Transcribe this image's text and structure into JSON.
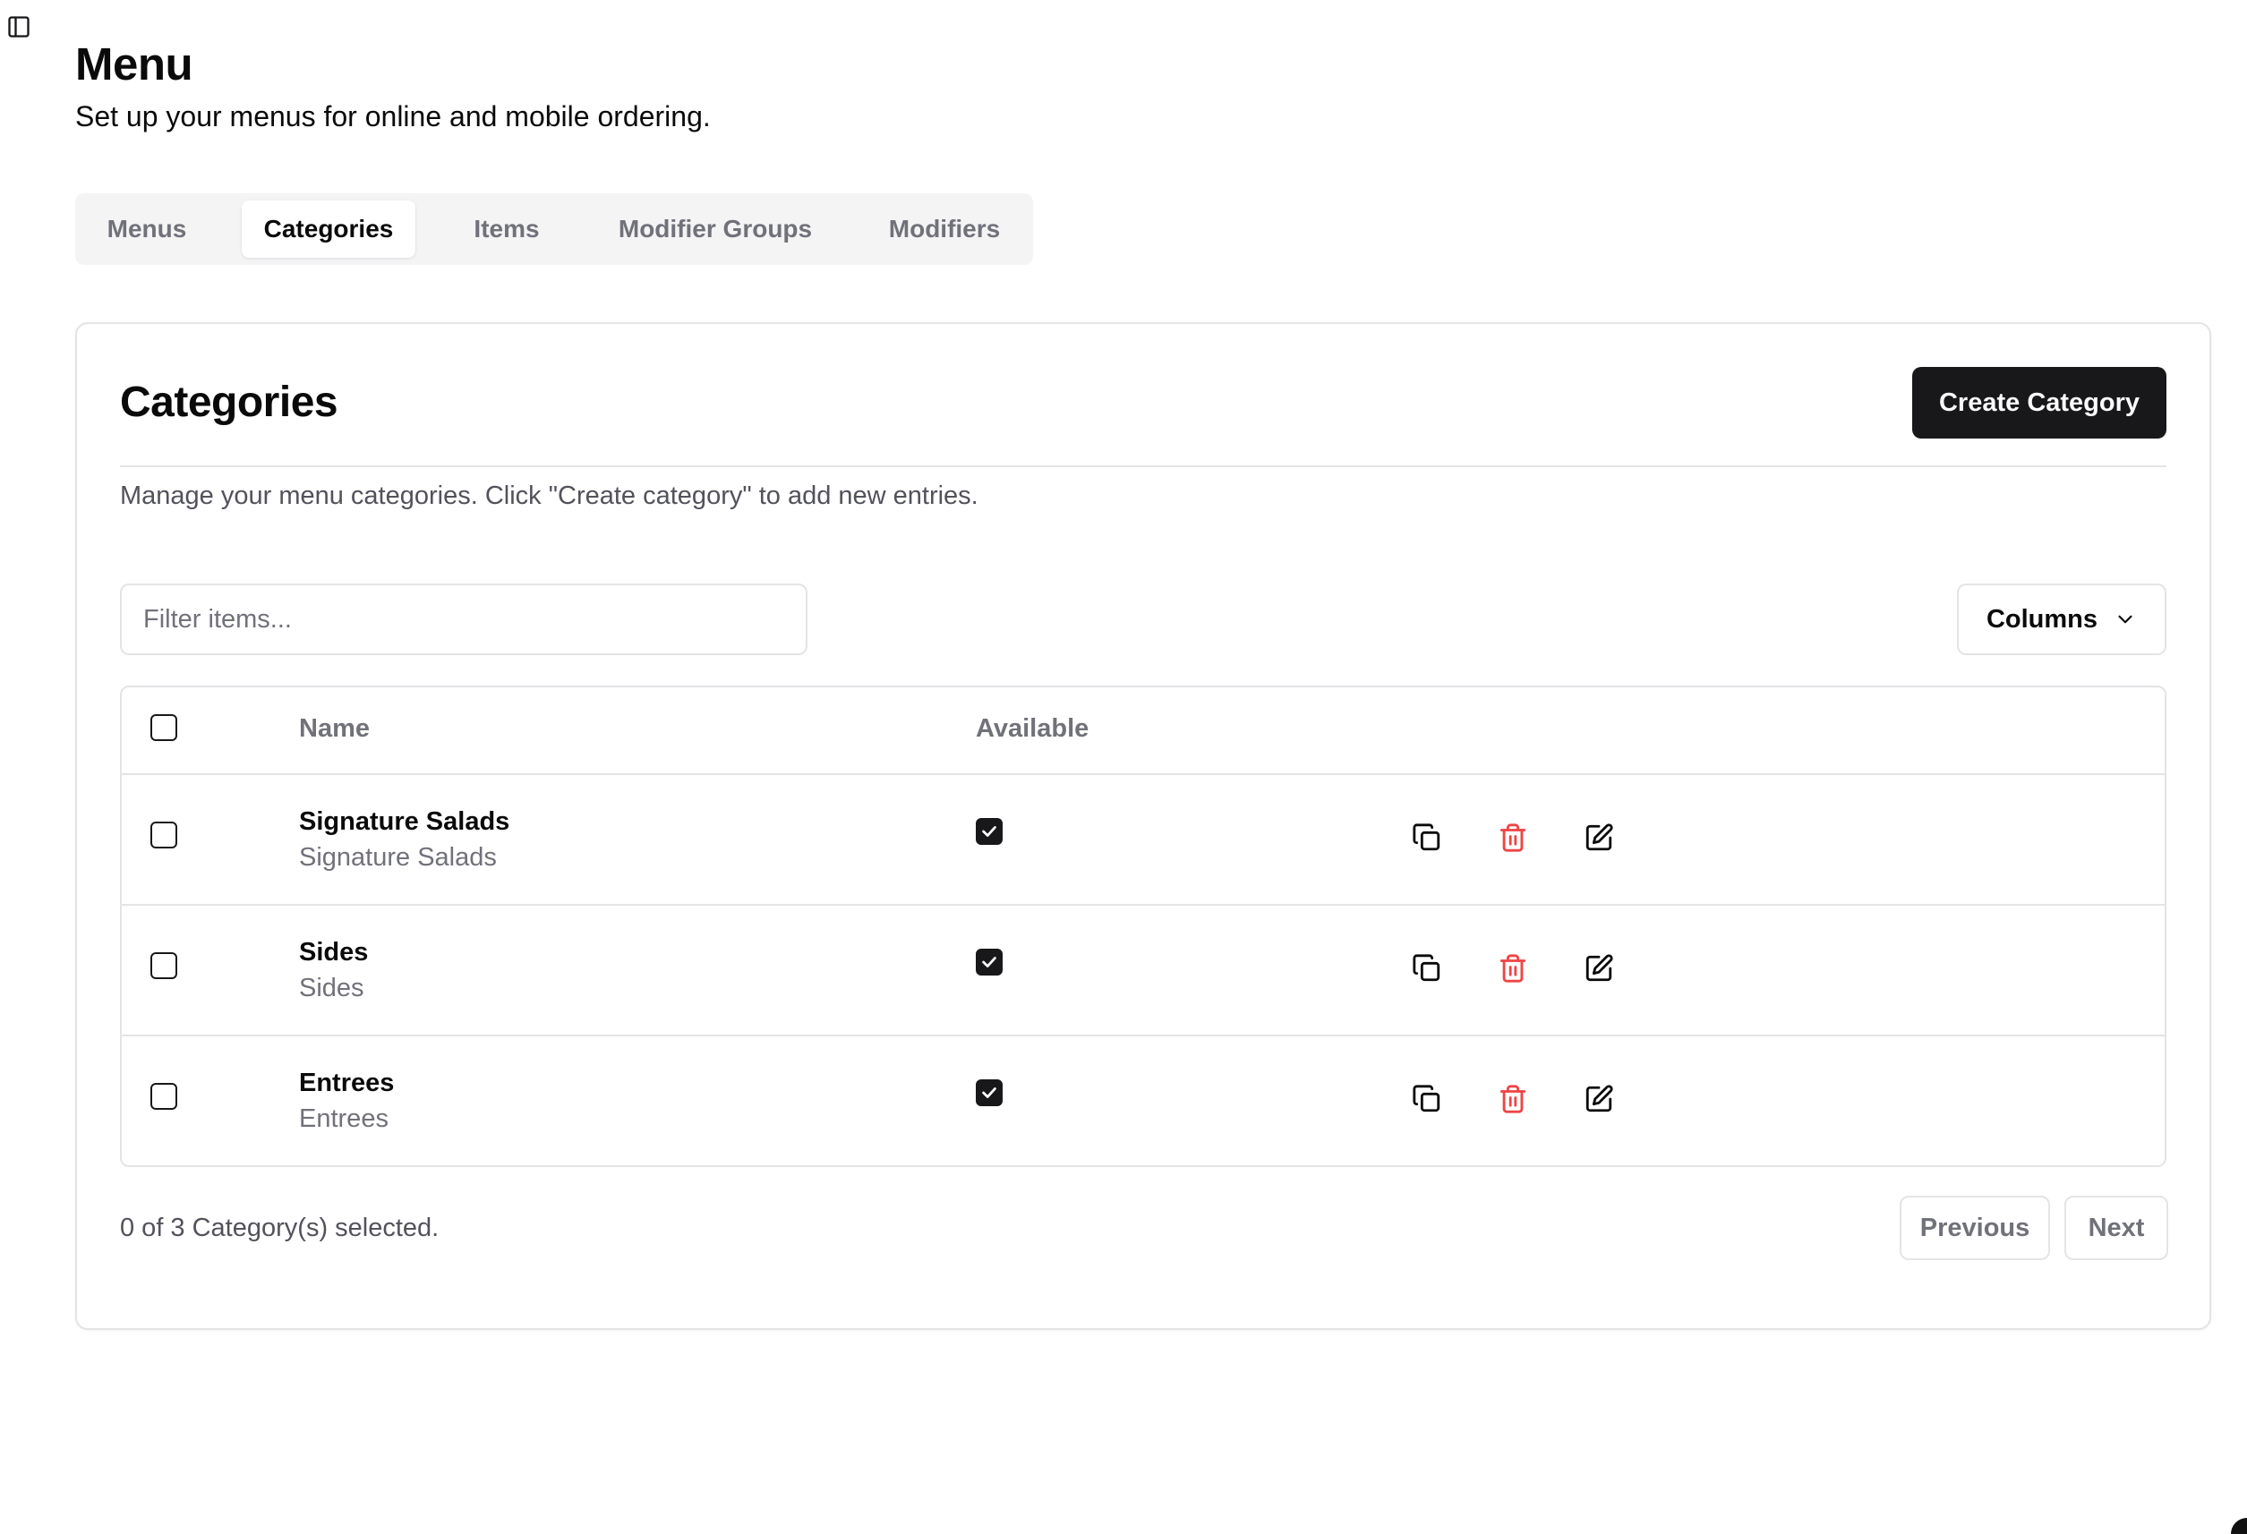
{
  "page": {
    "title": "Menu",
    "subtitle": "Set up your menus for online and mobile ordering."
  },
  "tabs": [
    {
      "label": "Menus",
      "active": false
    },
    {
      "label": "Categories",
      "active": true
    },
    {
      "label": "Items",
      "active": false
    },
    {
      "label": "Modifier Groups",
      "active": false
    },
    {
      "label": "Modifiers",
      "active": false
    }
  ],
  "card": {
    "title": "Categories",
    "create_button": "Create Category",
    "description": "Manage your menu categories. Click \"Create category\" to add new entries."
  },
  "filter": {
    "placeholder": "Filter items...",
    "value": ""
  },
  "columns_button": "Columns",
  "table": {
    "headers": {
      "name": "Name",
      "available": "Available"
    },
    "rows": [
      {
        "name": "Signature Salads",
        "subtitle": "Signature Salads",
        "available": true,
        "selected": false
      },
      {
        "name": "Sides",
        "subtitle": "Sides",
        "available": true,
        "selected": false
      },
      {
        "name": "Entrees",
        "subtitle": "Entrees",
        "available": true,
        "selected": false
      }
    ]
  },
  "footer": {
    "selection_text": "0 of 3 Category(s) selected.",
    "previous": "Previous",
    "next": "Next"
  },
  "icons": {
    "sidebar_toggle": "panel-left-icon",
    "columns_chevron": "chevron-down-icon",
    "row_actions": [
      "copy-icon",
      "trash-icon",
      "edit-icon"
    ]
  },
  "colors": {
    "primary": "#18181b",
    "muted": "#71717a",
    "border": "#e4e4e7",
    "tab_bg": "#f4f4f5",
    "danger": "#ef4444"
  }
}
